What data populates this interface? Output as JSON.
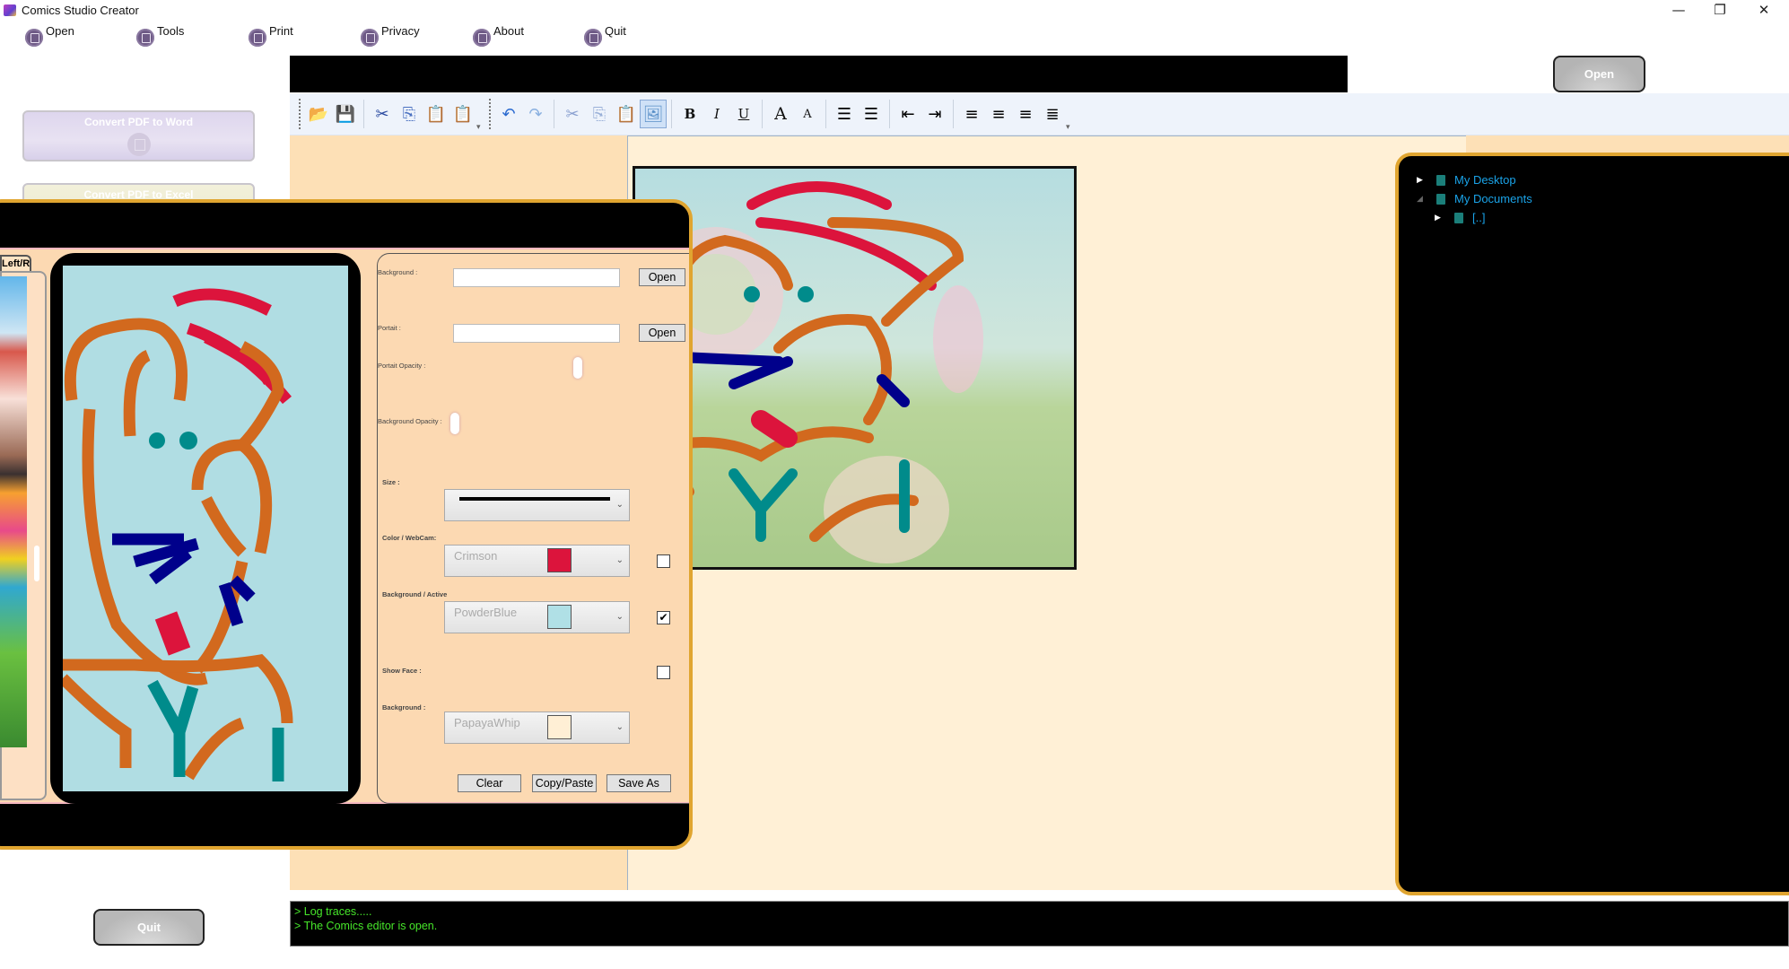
{
  "window": {
    "title": "Comics Studio Creator",
    "minimize": "—",
    "restore": "❐",
    "close": "✕"
  },
  "menu": [
    {
      "label": "Open",
      "icon": "printer-icon"
    },
    {
      "label": "Tools",
      "icon": "printer-icon"
    },
    {
      "label": "Print",
      "icon": "printer-icon"
    },
    {
      "label": "Privacy",
      "icon": "printer-icon"
    },
    {
      "label": "About",
      "icon": "printer-icon"
    },
    {
      "label": "Quit",
      "icon": "printer-icon"
    }
  ],
  "sidebar": {
    "convert_word": "Convert PDF to Word",
    "convert_excel": "Convert PDF to Excel",
    "quit": "Quit"
  },
  "header": {
    "open_button": "Open"
  },
  "toolbar": {
    "groups": [
      [
        "open-folder-icon",
        "save-icon"
      ],
      [
        "cut-icon",
        "copy-icon",
        "paste-icon",
        "paste-special-icon"
      ],
      [
        "undo-icon",
        "redo-icon"
      ],
      [
        "cut-icon",
        "copy-icon",
        "paste-icon",
        "insert-image-icon"
      ],
      [
        "bold-icon",
        "italic-icon",
        "underline-icon"
      ],
      [
        "grow-font-icon",
        "shrink-font-icon"
      ],
      [
        "bullet-list-icon",
        "numbered-list-icon"
      ],
      [
        "decrease-indent-icon",
        "increase-indent-icon"
      ],
      [
        "align-left-icon",
        "align-center-icon",
        "align-right-icon",
        "justify-icon"
      ]
    ],
    "bold": "B",
    "italic": "I",
    "underline": "U",
    "grow": "A",
    "shrink": "A"
  },
  "tree": {
    "items": [
      {
        "label": "My Desktop",
        "expanded": false,
        "level": 0
      },
      {
        "label": "My Documents",
        "expanded": true,
        "level": 0
      },
      {
        "label": "[..]",
        "expanded": false,
        "level": 1
      }
    ]
  },
  "log": {
    "lines": [
      "> Log traces.....",
      "> The Comics editor is open."
    ]
  },
  "dialog": {
    "thumb_tab": "Left/Right",
    "labels": {
      "background": "Background :",
      "portrait": "Portait :",
      "portrait_opacity": "Portait Opacity :",
      "background_opacity": "Background Opacity :",
      "size": "Size :",
      "color_webcam": "Color / WebCam:",
      "background_active": "Background / Active",
      "show_face": "Show Face :",
      "background2": "Background :"
    },
    "background_path": "",
    "portrait_path": "",
    "open_label": "Open",
    "portrait_opacity": 0.72,
    "background_opacity": 0.22,
    "color": {
      "name": "Crimson",
      "hex": "#DC143C"
    },
    "background_color": {
      "name": "PowderBlue",
      "hex": "#B0E0E6"
    },
    "page_color": {
      "name": "PapayaWhip",
      "hex": "#FFEFD5"
    },
    "webcam_checked": false,
    "active_checked": true,
    "show_face_checked": false,
    "buttons": {
      "clear": "Clear",
      "copy_paste": "Copy/Paste",
      "save_as": "Save As"
    }
  },
  "colors": {
    "accent_gold": "#E0A530",
    "stroke_orange": "#D2691E",
    "stroke_crimson": "#DC143C",
    "stroke_navy": "#00008B",
    "stroke_teal": "#008B8B",
    "log_green": "#46E62A",
    "tree_blue": "#1AA3E8"
  }
}
